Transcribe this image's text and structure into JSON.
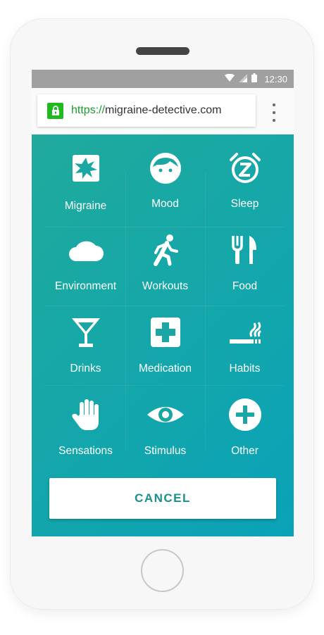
{
  "status_bar": {
    "time": "12:30",
    "icons": [
      "wifi-icon",
      "signal-icon",
      "battery-icon"
    ]
  },
  "browser": {
    "url_scheme": "https://",
    "url_host": "migraine-detective.com"
  },
  "categories": [
    {
      "label": "Migraine",
      "icon": "migraine-icon"
    },
    {
      "label": "Mood",
      "icon": "face-icon"
    },
    {
      "label": "Sleep",
      "icon": "alarm-clock-icon"
    },
    {
      "label": "Environment",
      "icon": "cloud-icon"
    },
    {
      "label": "Workouts",
      "icon": "running-icon"
    },
    {
      "label": "Food",
      "icon": "fork-knife-icon"
    },
    {
      "label": "Drinks",
      "icon": "cocktail-icon"
    },
    {
      "label": "Medication",
      "icon": "medical-cross-icon"
    },
    {
      "label": "Habits",
      "icon": "smoking-icon"
    },
    {
      "label": "Sensations",
      "icon": "hand-icon"
    },
    {
      "label": "Stimulus",
      "icon": "eye-icon"
    },
    {
      "label": "Other",
      "icon": "plus-circle-icon"
    }
  ],
  "actions": {
    "cancel_label": "CANCEL"
  },
  "colors": {
    "accent": "#16928a",
    "gradient_start": "#20aa9c",
    "gradient_end": "#0ba2b8",
    "lock": "#1fba1f"
  }
}
